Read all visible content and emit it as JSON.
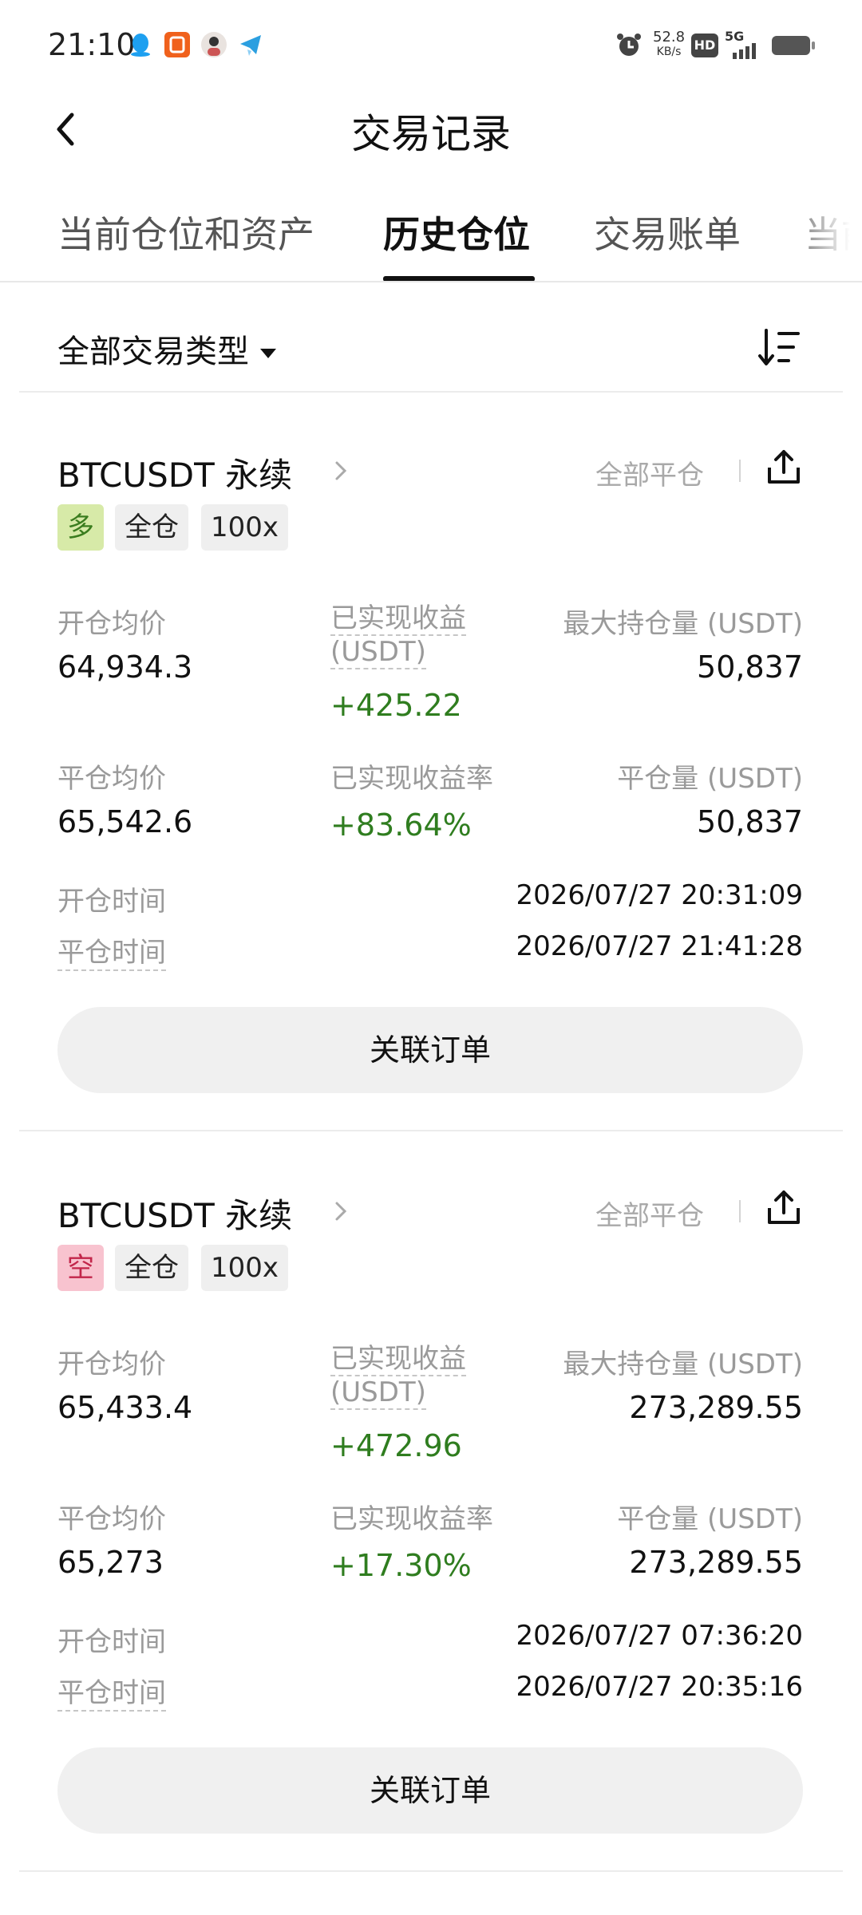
{
  "status_bar": {
    "time": "21:10",
    "net_speed_value": "52.8",
    "net_speed_unit": "KB/s",
    "hd": "HD",
    "network": "5G"
  },
  "header": {
    "title": "交易记录"
  },
  "tabs": [
    {
      "label": "当前仓位和资产"
    },
    {
      "label": "历史仓位"
    },
    {
      "label": "交易账单"
    },
    {
      "label": "当前"
    }
  ],
  "filter": {
    "label": "全部交易类型"
  },
  "cards": [
    {
      "symbol": "BTCUSDT 永续",
      "close_all": "全部平仓",
      "tags": [
        "多",
        "全仓",
        "100x"
      ],
      "side_color": "#d7eaa8",
      "side_text_color": "#3b7d1f",
      "open_price_label": "开仓均价",
      "open_price": "64,934.3",
      "pnl_label_1": "已实现收益",
      "pnl_label_2": "(USDT)",
      "pnl": "+425.22",
      "max_pos_label": "最大持仓量 (USDT)",
      "max_pos": "50,837",
      "close_price_label": "平仓均价",
      "close_price": "65,542.6",
      "roi_label": "已实现收益率",
      "roi": "+83.64%",
      "close_vol_label": "平仓量 (USDT)",
      "close_vol": "50,837",
      "open_time_label": "开仓时间",
      "open_time": "2026/07/27 20:31:09",
      "close_time_label": "平仓时间",
      "close_time": "2026/07/27 21:41:28",
      "related_orders": "关联订单"
    },
    {
      "symbol": "BTCUSDT 永续",
      "close_all": "全部平仓",
      "tags": [
        "空",
        "全仓",
        "100x"
      ],
      "side_color": "#f8c3cf",
      "side_text_color": "#c2264a",
      "open_price_label": "开仓均价",
      "open_price": "65,433.4",
      "pnl_label_1": "已实现收益",
      "pnl_label_2": "(USDT)",
      "pnl": "+472.96",
      "max_pos_label": "最大持仓量 (USDT)",
      "max_pos": "273,289.55",
      "close_price_label": "平仓均价",
      "close_price": "65,273",
      "roi_label": "已实现收益率",
      "roi": "+17.30%",
      "close_vol_label": "平仓量 (USDT)",
      "close_vol": "273,289.55",
      "open_time_label": "开仓时间",
      "open_time": "2026/07/27 07:36:20",
      "close_time_label": "平仓时间",
      "close_time": "2026/07/27 20:35:16",
      "related_orders": "关联订单"
    }
  ],
  "colors": {
    "profit_green": "#2f7d1f",
    "muted_label": "#9a9a9a",
    "button_bg": "#f0f0f0"
  }
}
